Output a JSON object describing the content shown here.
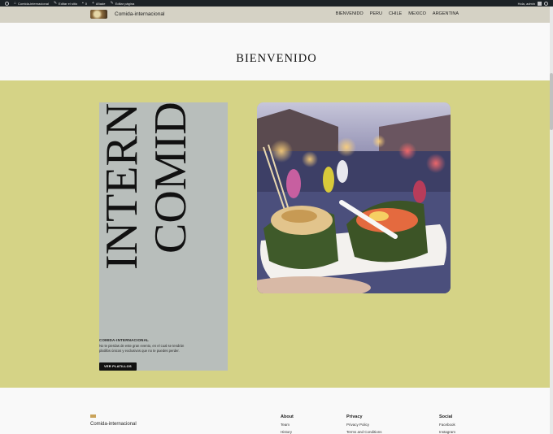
{
  "admin_bar": {
    "site_name": "Comida-internacional",
    "edit_site": "Editar el sitio",
    "comments_count": "0",
    "add_new": "Añade",
    "edit_page": "Editar página",
    "user": "Hola, admin"
  },
  "header": {
    "site_title": "Comida-internacional",
    "nav": [
      "BIENVENIDO",
      "PERU",
      "CHILE",
      "MEXICO",
      "ARGENTINA"
    ]
  },
  "page": {
    "title": "BIENVENIDO"
  },
  "hero": {
    "big_word_1": "INTERN",
    "big_word_2": "COMID",
    "heading": "COMIDA-INTERNACIONAL",
    "body": "No te pierdas de este gran evento, en el cual se tendrán platillos únicos y exclusivos que no te puedes perder.",
    "button": "VER PLATILLOS",
    "photo_icon": "street-food-photo"
  },
  "footer": {
    "site_title": "Comida-internacional",
    "columns": [
      {
        "heading": "About",
        "links": [
          "Team",
          "History"
        ]
      },
      {
        "heading": "Privacy",
        "links": [
          "Privacy Policy",
          "Terms and Conditions"
        ]
      },
      {
        "heading": "Social",
        "links": [
          "Facebook",
          "Instagram"
        ]
      }
    ]
  },
  "colors": {
    "admin_bar": "#1d2327",
    "header_bg": "#d5d2c5",
    "main_bg": "#d5d386",
    "card_bg": "#b8bebb",
    "button_bg": "#111111"
  }
}
